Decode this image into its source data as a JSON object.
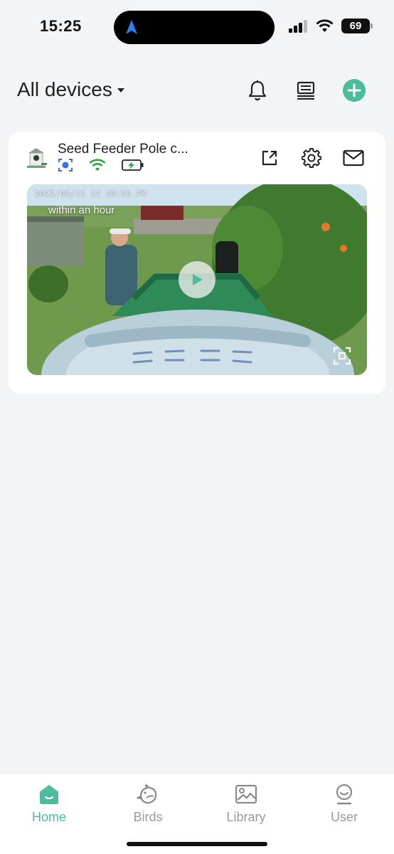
{
  "status_bar": {
    "time": "15:25",
    "battery": "69"
  },
  "header": {
    "title": "All devices",
    "icons": [
      "bell-icon",
      "device-list-icon",
      "add-icon"
    ]
  },
  "device_card": {
    "name": "Seed Feeder Pole c...",
    "status_icons": [
      "ai-detect-icon",
      "wifi-icon",
      "battery-charging-icon"
    ],
    "actions": [
      "share-icon",
      "gear-icon",
      "mail-icon"
    ],
    "video": {
      "timestamp": "2025/05/11 12 20:53 PM",
      "caption": "within an hour"
    }
  },
  "bottom_nav": {
    "items": [
      {
        "label": "Home",
        "icon": "home-icon",
        "active": true
      },
      {
        "label": "Birds",
        "icon": "bird-icon",
        "active": false
      },
      {
        "label": "Library",
        "icon": "image-icon",
        "active": false
      },
      {
        "label": "User",
        "icon": "user-icon",
        "active": false
      }
    ]
  },
  "colors": {
    "accent": "#4cbc9c",
    "background": "#f3f4f6",
    "ai_status": "#3b6fe0",
    "wifi_status": "#22a83a",
    "battery_status": "#22a83a"
  }
}
